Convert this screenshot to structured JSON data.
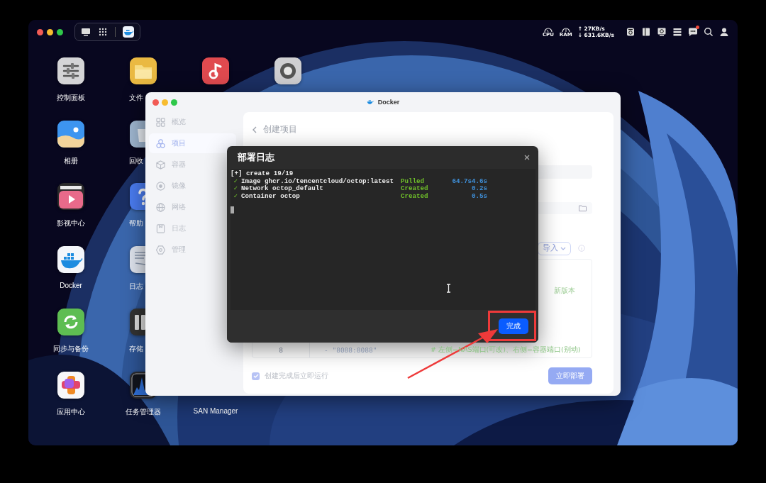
{
  "top_bar": {
    "cpu": "CPU",
    "ram": "RAM",
    "upload": "↑ 27KB/s",
    "download": "↓ 631.6KB/s",
    "notification": true
  },
  "desktop_icons": [
    {
      "label": "控制面板",
      "kind": "sliders"
    },
    {
      "label": "文件",
      "kind": "folder"
    },
    {
      "kind": "music"
    },
    {
      "kind": "disc"
    },
    {
      "label": "相册",
      "kind": "photos"
    },
    {
      "label": "回收",
      "kind": "trash"
    },
    {
      "label": "影视中心",
      "kind": "video"
    },
    {
      "label": "帮助",
      "kind": "help"
    },
    {
      "label": "Docker",
      "kind": "docker"
    },
    {
      "label": "日志",
      "kind": "log"
    },
    {
      "label": "同步与备份",
      "kind": "sync"
    },
    {
      "label": "存储",
      "kind": "storage"
    },
    {
      "label": "应用中心",
      "kind": "apps"
    },
    {
      "label": "任务管理器",
      "kind": "monitor"
    },
    {
      "label": "SAN Manager"
    }
  ],
  "docker_window": {
    "title": "Docker",
    "sidebar": [
      {
        "label": "概览",
        "kind": "grid",
        "selected": false
      },
      {
        "label": "项目",
        "kind": "circles",
        "selected": true
      },
      {
        "label": "容器",
        "kind": "cube",
        "selected": false
      },
      {
        "label": "镜像",
        "kind": "target",
        "selected": false
      },
      {
        "label": "网络",
        "kind": "globe",
        "selected": false
      },
      {
        "label": "日志",
        "kind": "note",
        "selected": false
      },
      {
        "label": "管理",
        "kind": "hexagon",
        "selected": false
      }
    ],
    "page_title": "创建项目",
    "import_button": "导入",
    "editor": {
      "note": "新版本",
      "line_number": "8",
      "code": "- \"8088:8088\"",
      "comment": "# 左侧=NAS端口(可改)、右侧=容器端口(别动)"
    },
    "run_after_create": {
      "label": "创建完成后立即运行",
      "checked": true
    },
    "deploy_button": {
      "label": "立即部署",
      "disabled": true
    }
  },
  "deploy_log": {
    "title": "部署日志",
    "lines": [
      {
        "kind": "header",
        "text": "[+] create 19/19"
      },
      {
        "kind": "step",
        "mark": "✓",
        "text": "Image ghcr.io/tencentcloud/octop:latest",
        "status": "Pulled",
        "time": "64.7s4.6s"
      },
      {
        "kind": "step",
        "mark": "✓",
        "text": "Network octop_default",
        "status": "Created",
        "time": "0.2s"
      },
      {
        "kind": "step",
        "mark": "✓",
        "text": "Container octop",
        "status": "Created",
        "time": "0.5s"
      }
    ],
    "done_button": "完成"
  }
}
